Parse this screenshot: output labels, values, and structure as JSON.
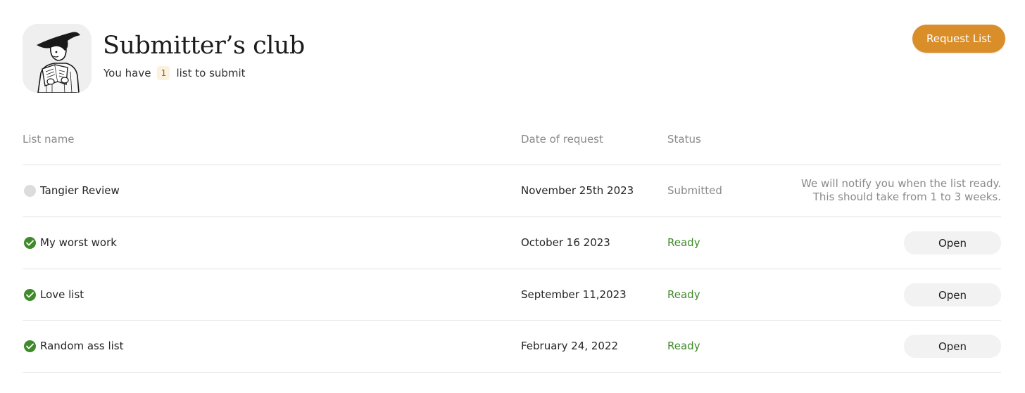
{
  "header": {
    "title": "Submitter’s club",
    "subtitle_prefix": "You have",
    "count": "1",
    "subtitle_suffix": "list to submit",
    "request_button": "Request List"
  },
  "table": {
    "columns": [
      "List name",
      "Date of request",
      "Status"
    ],
    "rows": [
      {
        "name": "Tangier Review",
        "date": "November 25th 2023",
        "status": "Submitted",
        "note_line1": "We will notify you when the list ready.",
        "note_line2": "This should take from 1 to 3 weeks."
      },
      {
        "name": "My worst work",
        "date": "October 16 2023",
        "status": "Ready",
        "action": "Open"
      },
      {
        "name": "Love list",
        "date": "September 11,2023",
        "status": "Ready",
        "action": "Open"
      },
      {
        "name": "Random ass list",
        "date": "February 24, 2022",
        "status": "Ready",
        "action": "Open"
      }
    ]
  },
  "colors": {
    "accent": "#d98e2a",
    "ready": "#3f8a2a",
    "muted": "#8a8a8a"
  }
}
